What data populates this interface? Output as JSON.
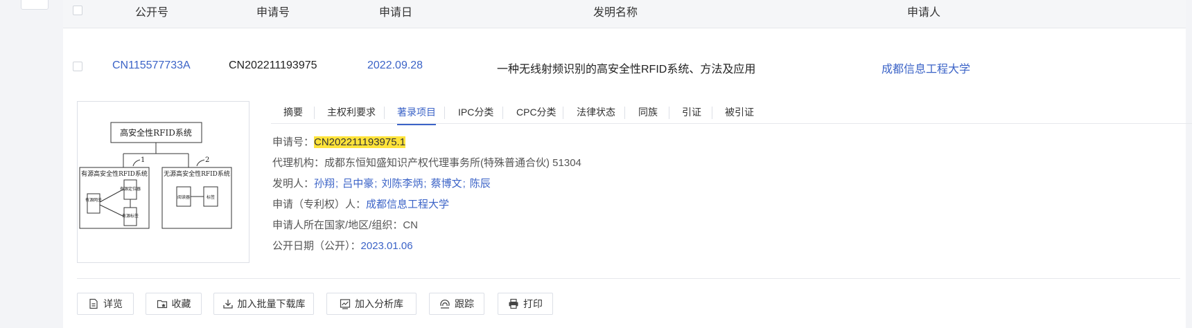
{
  "header": {
    "col_pubno": "公开号",
    "col_appno": "申请号",
    "col_appdate": "申请日",
    "col_title": "发明名称",
    "col_applicant": "申请人"
  },
  "row": {
    "pubno": "CN115577733A",
    "appno": "CN202211193975",
    "appdate": "2022.09.28",
    "title": "一种无线射频识别的高安全性RFID系统、方法及应用",
    "applicant": "成都信息工程大学"
  },
  "figure": {
    "top": "高安全性RFID系统",
    "left_title": "有源高安全性RFID系统",
    "right_title": "无源高安全性RFID系统",
    "label1": "1",
    "label2": "2",
    "left_gateway": "有源网关",
    "left_locator": "有源定位器",
    "left_tag": "有源标签",
    "right_reader": "阅读器",
    "right_tag": "标签"
  },
  "tabs": [
    "摘要",
    "主权利要求",
    "著录项目",
    "IPC分类",
    "CPC分类",
    "法律状态",
    "同族",
    "引证",
    "被引证"
  ],
  "active_tab": "著录项目",
  "info": {
    "appno_label": "申请号：",
    "appno_value": "CN202211193975.1",
    "agency_label": "代理机构：",
    "agency_value": "成都东恒知盛知识产权代理事务所(特殊普通合伙) 51304",
    "inventor_label": "发明人：",
    "inventors": [
      "孙翔",
      "吕中豪",
      "刘陈李炳",
      "蔡博文",
      "陈辰"
    ],
    "inventor_sep": ";",
    "applicant_label": "申请（专利权）人：",
    "applicant_value": "成都信息工程大学",
    "country_label": "申请人所在国家/地区/组织：",
    "country_value": "CN",
    "pubdate_label": "公开日期（公开）：",
    "pubdate_value": "2023.01.06"
  },
  "buttons": {
    "detail": "详览",
    "favorite": "收藏",
    "batch_download": "加入批量下载库",
    "analysis": "加入分析库",
    "track": "跟踪",
    "print": "打印"
  },
  "colors": {
    "link": "#3b63c7",
    "highlight": "#ffe33a"
  }
}
